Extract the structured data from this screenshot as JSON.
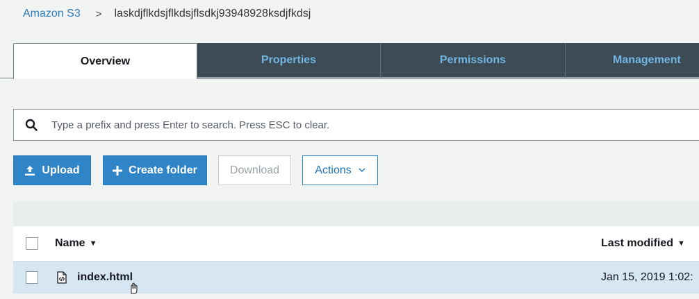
{
  "breadcrumb": {
    "root": "Amazon S3",
    "separator": ">",
    "current": "laskdjflkdsjflkdsjflsdkj93948928ksdjfkdsj"
  },
  "tabs": [
    {
      "label": "Overview",
      "active": true
    },
    {
      "label": "Properties",
      "active": false
    },
    {
      "label": "Permissions",
      "active": false
    },
    {
      "label": "Management",
      "active": false
    }
  ],
  "search": {
    "icon": "search-icon",
    "placeholder": "Type a prefix and press Enter to search. Press ESC to clear.",
    "value": ""
  },
  "toolbar": {
    "upload_label": "Upload",
    "create_folder_label": "Create folder",
    "download_label": "Download",
    "actions_label": "Actions"
  },
  "table": {
    "columns": {
      "name": "Name",
      "last_modified": "Last modified"
    },
    "rows": [
      {
        "name": "index.html",
        "last_modified": "Jan 15, 2019 1:02:",
        "icon": "html-file-icon",
        "selected": false,
        "hovered": true
      }
    ]
  },
  "colors": {
    "link": "#2c7cbd",
    "tab_dark": "#3d4b55",
    "tab_text": "#72b6e4",
    "primary": "#2f85c8",
    "row_highlight": "#d7e6f3"
  }
}
